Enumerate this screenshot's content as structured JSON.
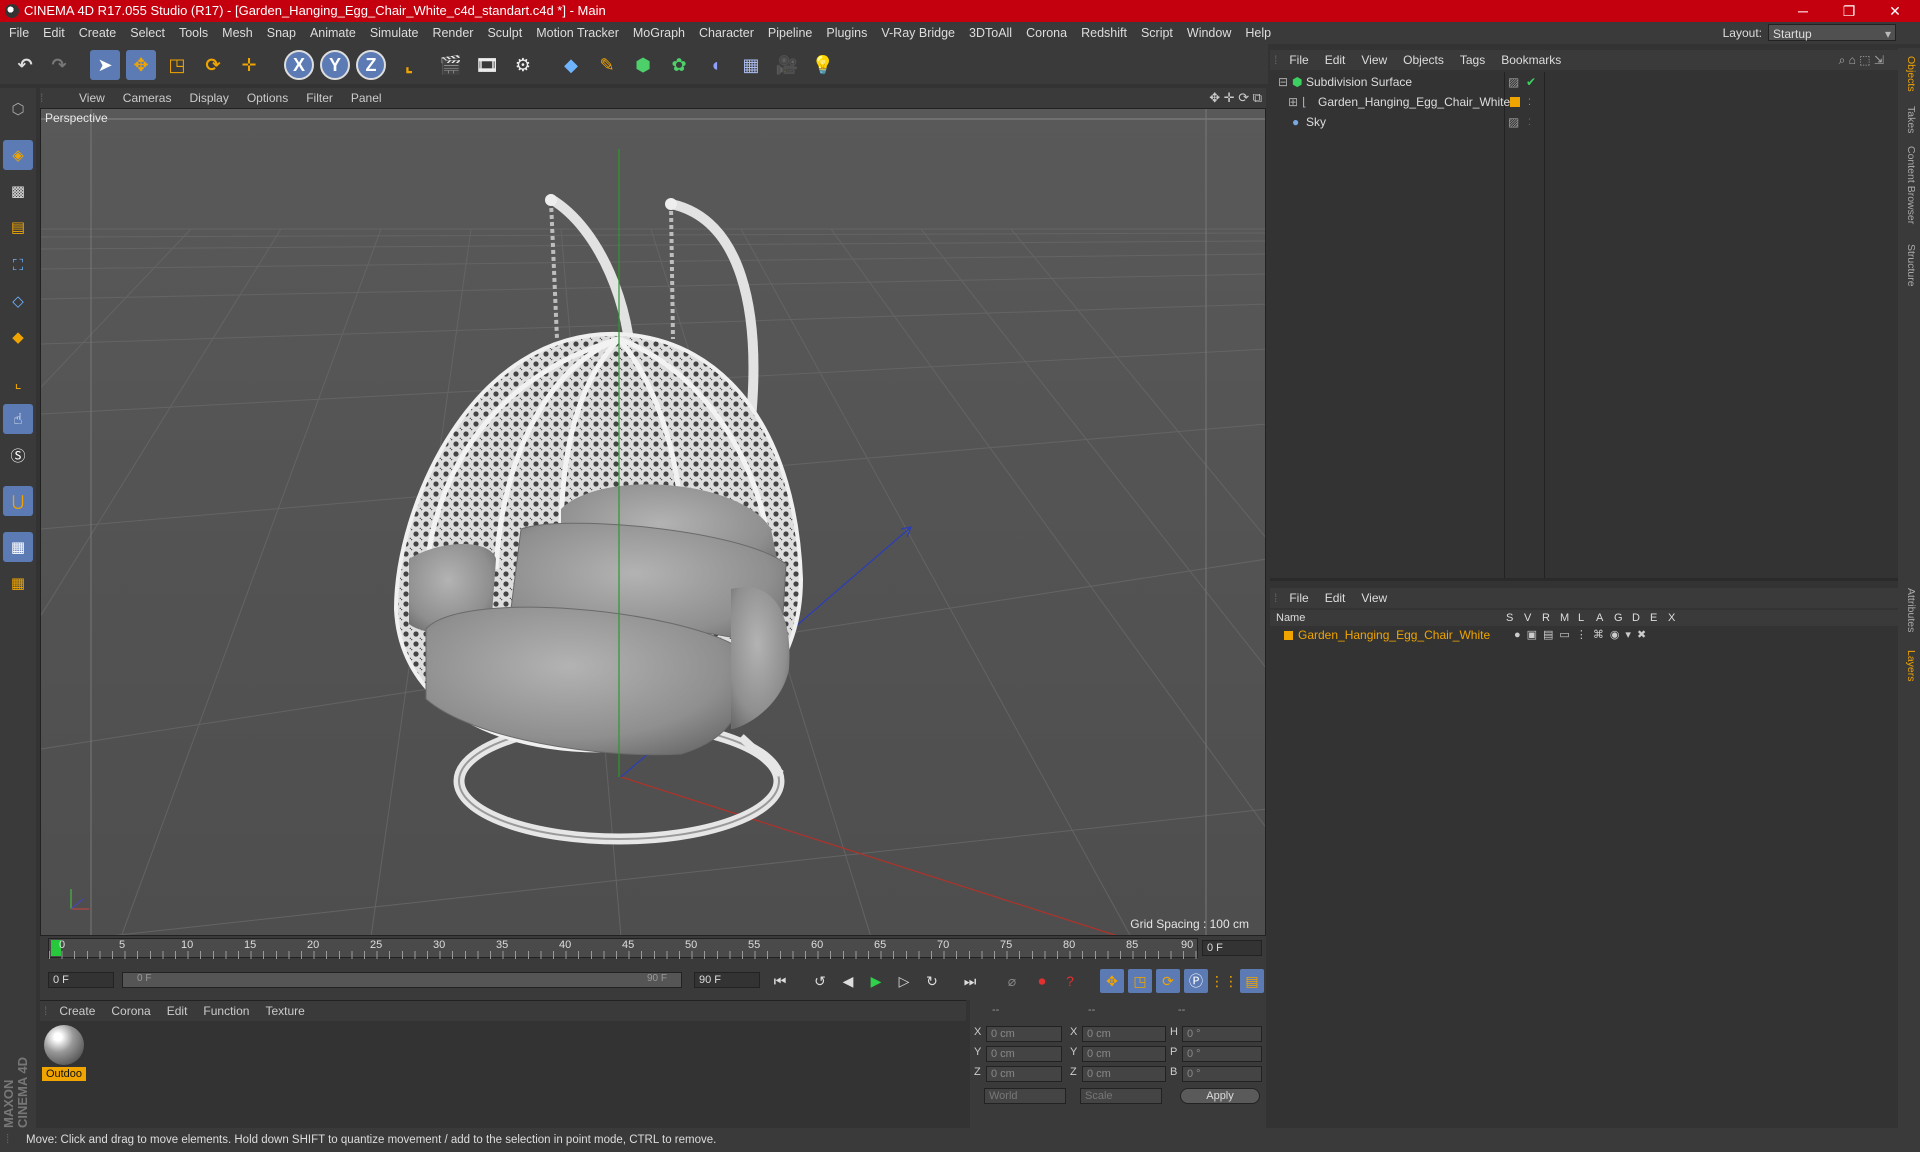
{
  "window": {
    "title": "CINEMA 4D R17.055 Studio (R17) - [Garden_Hanging_Egg_Chair_White_c4d_standart.c4d *] - Main",
    "minimize": "─",
    "maximize": "❐",
    "close": "✕"
  },
  "menubar": {
    "items": [
      "File",
      "Edit",
      "Create",
      "Select",
      "Tools",
      "Mesh",
      "Snap",
      "Animate",
      "Simulate",
      "Render",
      "Sculpt",
      "Motion Tracker",
      "MoGraph",
      "Character",
      "Pipeline",
      "Plugins",
      "V-Ray Bridge",
      "3DToAll",
      "Corona",
      "Redshift",
      "Script",
      "Window",
      "Help"
    ],
    "layout_label": "Layout:",
    "layout_value": "Startup"
  },
  "viewport": {
    "menu": [
      "View",
      "Cameras",
      "Display",
      "Options",
      "Filter",
      "Panel"
    ],
    "label": "Perspective",
    "grid_spacing": "Grid Spacing : 100 cm"
  },
  "timeline": {
    "ticks": [
      "0",
      "5",
      "10",
      "15",
      "20",
      "25",
      "30",
      "35",
      "40",
      "45",
      "50",
      "55",
      "60",
      "65",
      "70",
      "75",
      "80",
      "85",
      "90"
    ],
    "current_frame": "0 F",
    "start_field": "0 F",
    "range_start": "0 F",
    "range_end": "90 F",
    "end_field": "90 F"
  },
  "materials": {
    "menu": [
      "Create",
      "Corona",
      "Edit",
      "Function",
      "Texture"
    ],
    "items": [
      {
        "name": "Outdoo"
      }
    ]
  },
  "coordinates": {
    "header": [
      "--",
      "--",
      "--"
    ],
    "rows": [
      {
        "a": "X",
        "v1": "0 cm",
        "b": "X",
        "v2": "0 cm",
        "c": "H",
        "v3": "0 °"
      },
      {
        "a": "Y",
        "v1": "0 cm",
        "b": "Y",
        "v2": "0 cm",
        "c": "P",
        "v3": "0 °"
      },
      {
        "a": "Z",
        "v1": "0 cm",
        "b": "Z",
        "v2": "0 cm",
        "c": "B",
        "v3": "0 °"
      }
    ],
    "world": "World",
    "scale": "Scale",
    "apply": "Apply"
  },
  "objects": {
    "menu": [
      "File",
      "Edit",
      "View",
      "Objects",
      "Tags",
      "Bookmarks"
    ],
    "items": [
      {
        "name": "Subdivision Surface"
      },
      {
        "name": "Garden_Hanging_Egg_Chair_White"
      },
      {
        "name": "Sky"
      }
    ]
  },
  "layers": {
    "menu": [
      "File",
      "Edit",
      "View"
    ],
    "columns": [
      "Name",
      "S",
      "V",
      "R",
      "M",
      "L",
      "A",
      "G",
      "D",
      "E",
      "X"
    ],
    "items": [
      {
        "name": "Garden_Hanging_Egg_Chair_White"
      }
    ]
  },
  "sidetabs": [
    "Objects",
    "Takes",
    "Content Browser",
    "Structure",
    "Attributes",
    "Layers"
  ],
  "brand": "MAXON CINEMA 4D",
  "status": "Move: Click and drag to move elements. Hold down SHIFT to quantize movement / add to the selection in point mode, CTRL to remove.",
  "colors": {
    "title_bar": "#c5000e",
    "accent": "#f0a400",
    "selection": "#4a6ea8"
  }
}
